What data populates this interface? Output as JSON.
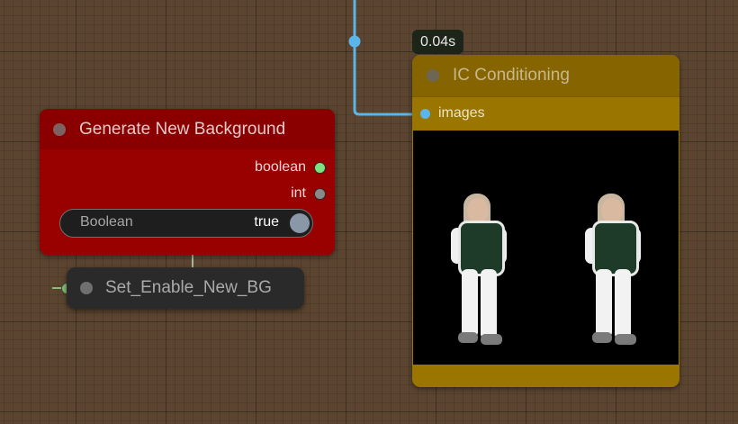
{
  "badge": {
    "text": "0.04s"
  },
  "ic_node": {
    "title": "IC Conditioning",
    "input_label": "images"
  },
  "gen_node": {
    "title": "Generate New Background",
    "outputs": [
      {
        "label": "boolean",
        "color": "#7ee07e"
      },
      {
        "label": "int",
        "color": "#8a8a8a"
      }
    ],
    "widget": {
      "label": "Boolean",
      "value": "true"
    }
  },
  "set_node": {
    "title": "Set_Enable_New_BG"
  },
  "colors": {
    "canvas": "#5b4530",
    "ic_body": "#9a7500",
    "gen_body": "#990000",
    "image_wire": "#5ab5e8",
    "boolean_wire": "#8cb87a"
  }
}
